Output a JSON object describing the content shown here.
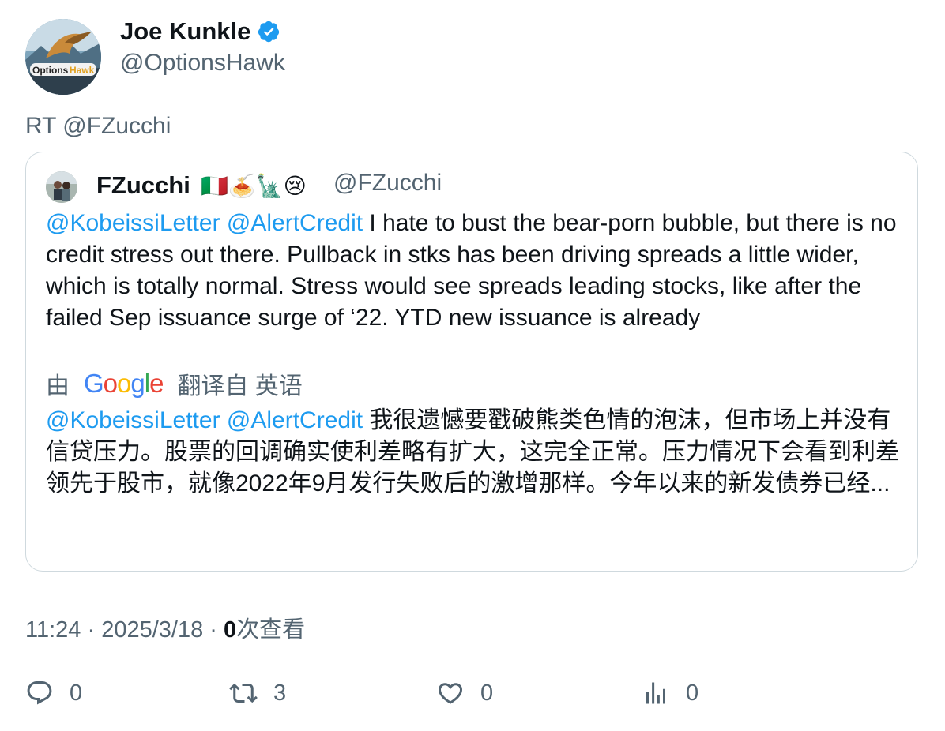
{
  "author": {
    "name": "Joe Kunkle",
    "handle": "@OptionsHawk",
    "avatar_text": "OptionsHawk",
    "verified_icon": "verified-badge-icon"
  },
  "retweet_line": "RT @FZucchi",
  "quote": {
    "name": "FZucchi",
    "flags": "🇮🇹🍝🗽😢",
    "handle": "@FZucchi",
    "mention1": "@KobeissiLetter",
    "mention2": "@AlertCredit",
    "text": "I hate to bust the bear-porn bubble, but there is no credit stress out there. Pullback in stks has been driving spreads a little wider, which is totally normal. Stress would see spreads leading stocks, like after the failed Sep issuance surge of ‘22. YTD new issuance is already",
    "translate_prefix": "由",
    "translate_brand": "Google",
    "translate_suffix": "翻译自 英语",
    "translated_mention1": "@KobeissiLetter",
    "translated_mention2": "@AlertCredit",
    "translated_text": "我很遗憾要戳破熊类色情的泡沫，但市场上并没有信贷压力。股票的回调确实使利差略有扩大，这完全正常。压力情况下会看到利差领先于股市，就像2022年9月发行失败后的激增那样。今年以来的新发债券已经..."
  },
  "meta": {
    "time": "11:24",
    "sep1": " · ",
    "date": "2025/3/18",
    "sep2": " · ",
    "views_count": "0",
    "views_label": "次查看"
  },
  "actions": {
    "replies": "0",
    "retweets": "3",
    "likes": "0",
    "views": "0"
  },
  "colors": {
    "link": "#1d9bf0",
    "secondary": "#536471",
    "text": "#0f1419",
    "border": "#cfd9de",
    "verified": "#1d9bf0"
  }
}
